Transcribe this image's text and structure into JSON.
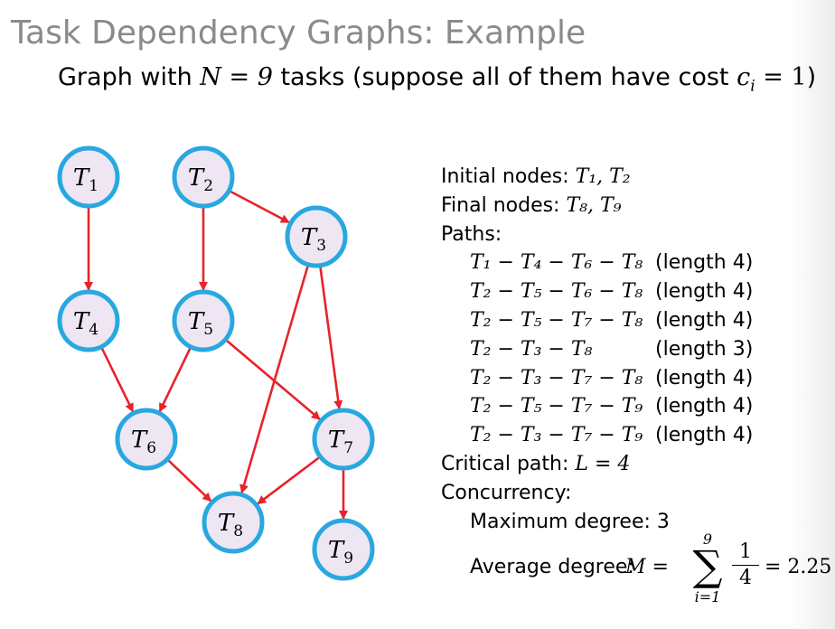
{
  "title": "Task Dependency Graphs: Example",
  "subtitle": {
    "prefix": "Graph with ",
    "n_expr": "N = 9",
    "middle": " tasks (suppose all of them have cost ",
    "cost_expr": "c",
    "cost_sub": "i",
    "cost_rest": " = 1",
    "suffix": ")"
  },
  "colors": {
    "node_fill": "#efe6f3",
    "node_stroke": "#29a8e0",
    "edge": "#e8232a",
    "title": "#8a8a8a"
  },
  "graph": {
    "nodes": [
      {
        "id": "T1",
        "label": "T",
        "sub": "1"
      },
      {
        "id": "T2",
        "label": "T",
        "sub": "2"
      },
      {
        "id": "T3",
        "label": "T",
        "sub": "3"
      },
      {
        "id": "T4",
        "label": "T",
        "sub": "4"
      },
      {
        "id": "T5",
        "label": "T",
        "sub": "5"
      },
      {
        "id": "T6",
        "label": "T",
        "sub": "6"
      },
      {
        "id": "T7",
        "label": "T",
        "sub": "7"
      },
      {
        "id": "T8",
        "label": "T",
        "sub": "8"
      },
      {
        "id": "T9",
        "label": "T",
        "sub": "9"
      }
    ],
    "edges": [
      [
        "T1",
        "T4"
      ],
      [
        "T2",
        "T5"
      ],
      [
        "T2",
        "T3"
      ],
      [
        "T3",
        "T8"
      ],
      [
        "T3",
        "T7"
      ],
      [
        "T4",
        "T6"
      ],
      [
        "T5",
        "T6"
      ],
      [
        "T5",
        "T7"
      ],
      [
        "T6",
        "T8"
      ],
      [
        "T7",
        "T8"
      ],
      [
        "T7",
        "T9"
      ]
    ]
  },
  "info": {
    "initial_label": "Initial nodes:",
    "initial_value": "T₁, T₂",
    "final_label": "Final nodes:",
    "final_value": "T₈, T₉",
    "paths_label": "Paths:",
    "paths": [
      {
        "expr": "T₁ − T₄ − T₆ − T₈",
        "length": "(length 4)"
      },
      {
        "expr": "T₂ − T₅ − T₆ − T₈",
        "length": "(length 4)"
      },
      {
        "expr": "T₂ − T₅ − T₇ − T₈",
        "length": "(length 4)"
      },
      {
        "expr": "T₂ − T₃ − T₈",
        "length": "(length 3)"
      },
      {
        "expr": "T₂ − T₃ − T₇ − T₈",
        "length": "(length 4)"
      },
      {
        "expr": "T₂ − T₅ − T₇ − T₉",
        "length": "(length 4)"
      },
      {
        "expr": "T₂ − T₃ − T₇ − T₉",
        "length": "(length 4)"
      }
    ],
    "critical_label": "Critical path:",
    "critical_value": "L = 4",
    "concurrency_label": "Concurrency:",
    "max_degree": "Maximum degree: 3",
    "avg_label": "Average degree:",
    "avg_lhs": "M =",
    "sum_top": "9",
    "sum_symbol": "∑",
    "sum_bottom": "i=1",
    "frac_num": "1",
    "frac_den": "4",
    "avg_result": "= 2.25"
  }
}
